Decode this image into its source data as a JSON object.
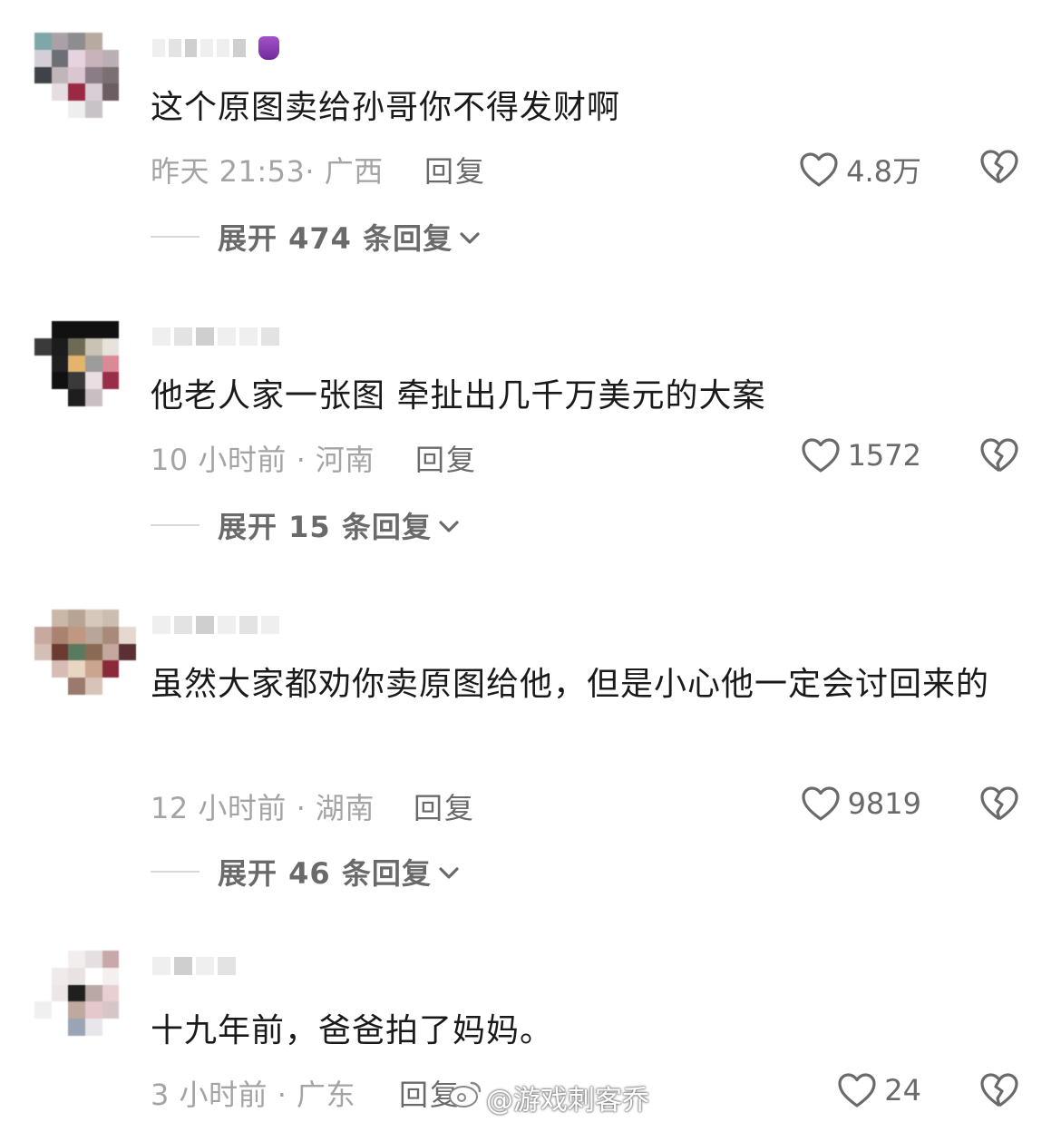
{
  "comments": [
    {
      "text": "这个原图卖给孙哥你不得发财啊",
      "time_location": "昨天 21:53· 广西",
      "reply": "回复",
      "likes": "4.8万",
      "expand": "展开 474 条回复"
    },
    {
      "text": "他老人家一张图 牵扯出几千万美元的大案",
      "time_location": "10 小时前 · 河南",
      "reply": "回复",
      "likes": "1572",
      "expand": "展开 15 条回复"
    },
    {
      "text": "虽然大家都劝你卖原图给他，但是小心他一定会讨回来的",
      "time_location": "12 小时前 · 湖南",
      "reply": "回复",
      "likes": "9819",
      "expand": "展开 46 条回复"
    },
    {
      "text": "十九年前，爸爸拍了妈妈。",
      "time_location": "3 小时前 · 广东",
      "reply": "回复",
      "likes": "24"
    }
  ],
  "watermark": "@游戏刺客乔",
  "icons": {
    "like": "heart-outline-icon",
    "dislike": "broken-heart-icon",
    "expand": "chevron-down-icon",
    "watermark": "weibo-logo-icon",
    "badge": "purple-badge-icon"
  },
  "colors": {
    "text": "#1a1a1a",
    "meta": "#a4a4a4",
    "action": "#6a6a6a",
    "badge": "#8a3cb5"
  }
}
